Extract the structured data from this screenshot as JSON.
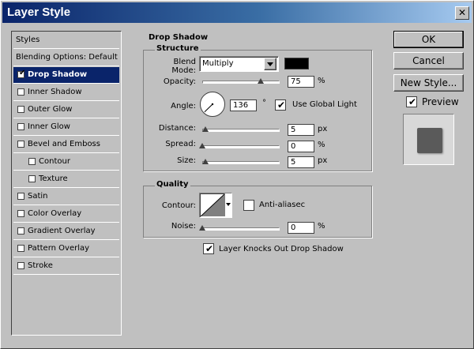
{
  "window": {
    "title": "Layer Style"
  },
  "styles_list": {
    "header": "Styles",
    "blending": "Blending Options: Default",
    "items": [
      {
        "label": "Drop Shadow",
        "checked": true,
        "selected": true,
        "sub": false
      },
      {
        "label": "Inner Shadow",
        "checked": false,
        "selected": false,
        "sub": false
      },
      {
        "label": "Outer Glow",
        "checked": false,
        "selected": false,
        "sub": false
      },
      {
        "label": "Inner Glow",
        "checked": false,
        "selected": false,
        "sub": false
      },
      {
        "label": "Bevel and Emboss",
        "checked": false,
        "selected": false,
        "sub": false
      },
      {
        "label": "Contour",
        "checked": false,
        "selected": false,
        "sub": true
      },
      {
        "label": "Texture",
        "checked": false,
        "selected": false,
        "sub": true
      },
      {
        "label": "Satin",
        "checked": false,
        "selected": false,
        "sub": false
      },
      {
        "label": "Color Overlay",
        "checked": false,
        "selected": false,
        "sub": false
      },
      {
        "label": "Gradient Overlay",
        "checked": false,
        "selected": false,
        "sub": false
      },
      {
        "label": "Pattern Overlay",
        "checked": false,
        "selected": false,
        "sub": false
      },
      {
        "label": "Stroke",
        "checked": false,
        "selected": false,
        "sub": false
      }
    ]
  },
  "drop_shadow": {
    "section_title": "Drop Shadow",
    "structure": {
      "title": "Structure",
      "blend_mode_label": "Blend Mode:",
      "blend_mode_value": "Multiply",
      "shadow_color": "#000000",
      "opacity_label": "Opacity:",
      "opacity_value": "75",
      "opacity_fraction": 0.75,
      "angle_label": "Angle:",
      "angle_value": "136",
      "angle_unit": "°",
      "use_global_light_label": "Use Global Light",
      "use_global_light": true,
      "distance_label": "Distance:",
      "distance_value": "5",
      "spread_label": "Spread:",
      "spread_value": "0",
      "size_label": "Size:",
      "size_value": "5",
      "px": "px",
      "pct": "%"
    },
    "quality": {
      "title": "Quality",
      "contour_label": "Contour:",
      "anti_aliased_label": "Anti-aliasec",
      "anti_aliased": false,
      "noise_label": "Noise:",
      "noise_value": "0"
    },
    "knockout_label": "Layer Knocks Out Drop Shadow",
    "knockout": true
  },
  "buttons": {
    "ok": "OK",
    "cancel": "Cancel",
    "new_style": "New Style..."
  },
  "preview": {
    "label": "Preview",
    "checked": true
  },
  "checkmark": "✔",
  "close_glyph": "✕"
}
